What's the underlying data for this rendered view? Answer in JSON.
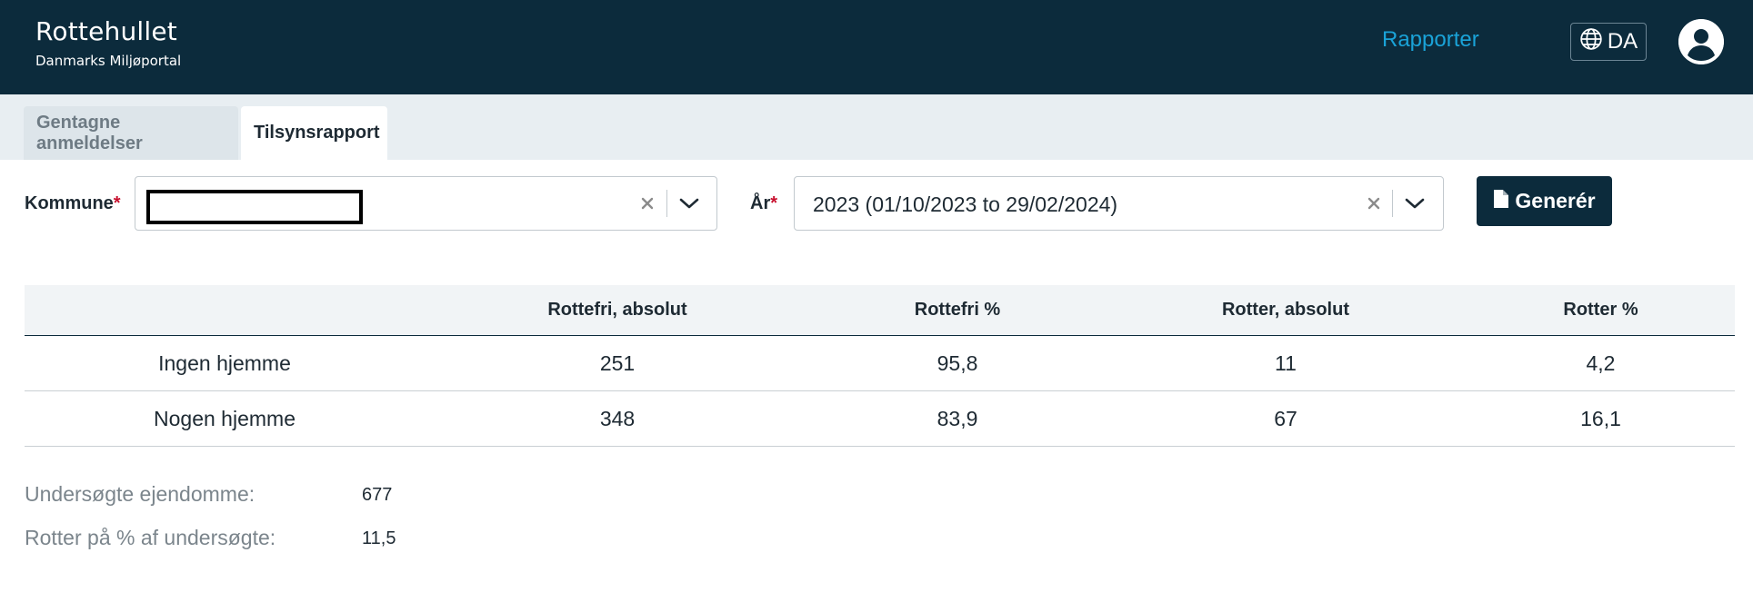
{
  "header": {
    "app_title": "Rottehullet",
    "app_subtitle": "Danmarks Miljøportal",
    "nav_reports": "Rapporter",
    "language": "DA",
    "icons": {
      "language": "globe-icon",
      "user": "user-circle-icon"
    }
  },
  "tabs": [
    {
      "label": "Gentagne anmeldelser",
      "active": false
    },
    {
      "label": "Tilsynsrapport",
      "active": true
    }
  ],
  "filters": {
    "kommune_label": "Kommune",
    "year_label": "År",
    "required_mark": "*",
    "year_value": "2023 (01/10/2023 to 29/02/2024)",
    "generate_label": "Generér"
  },
  "table": {
    "headers": [
      "",
      "Rottefri, absolut",
      "Rottefri %",
      "Rotter, absolut",
      "Rotter %"
    ],
    "rows": [
      [
        "Ingen hjemme",
        "251",
        "95,8",
        "11",
        "4,2"
      ],
      [
        "Nogen hjemme",
        "348",
        "83,9",
        "67",
        "16,1"
      ]
    ]
  },
  "summary": [
    {
      "label": "Undersøgte ejendomme:",
      "value": "677"
    },
    {
      "label": "Rotter på % af undersøgte:",
      "value": "11,5"
    }
  ],
  "colors": {
    "header_bg": "#0c2b3c",
    "link": "#1aa3d8",
    "required": "#c8102e",
    "tabbar_bg": "#e8eef2"
  }
}
